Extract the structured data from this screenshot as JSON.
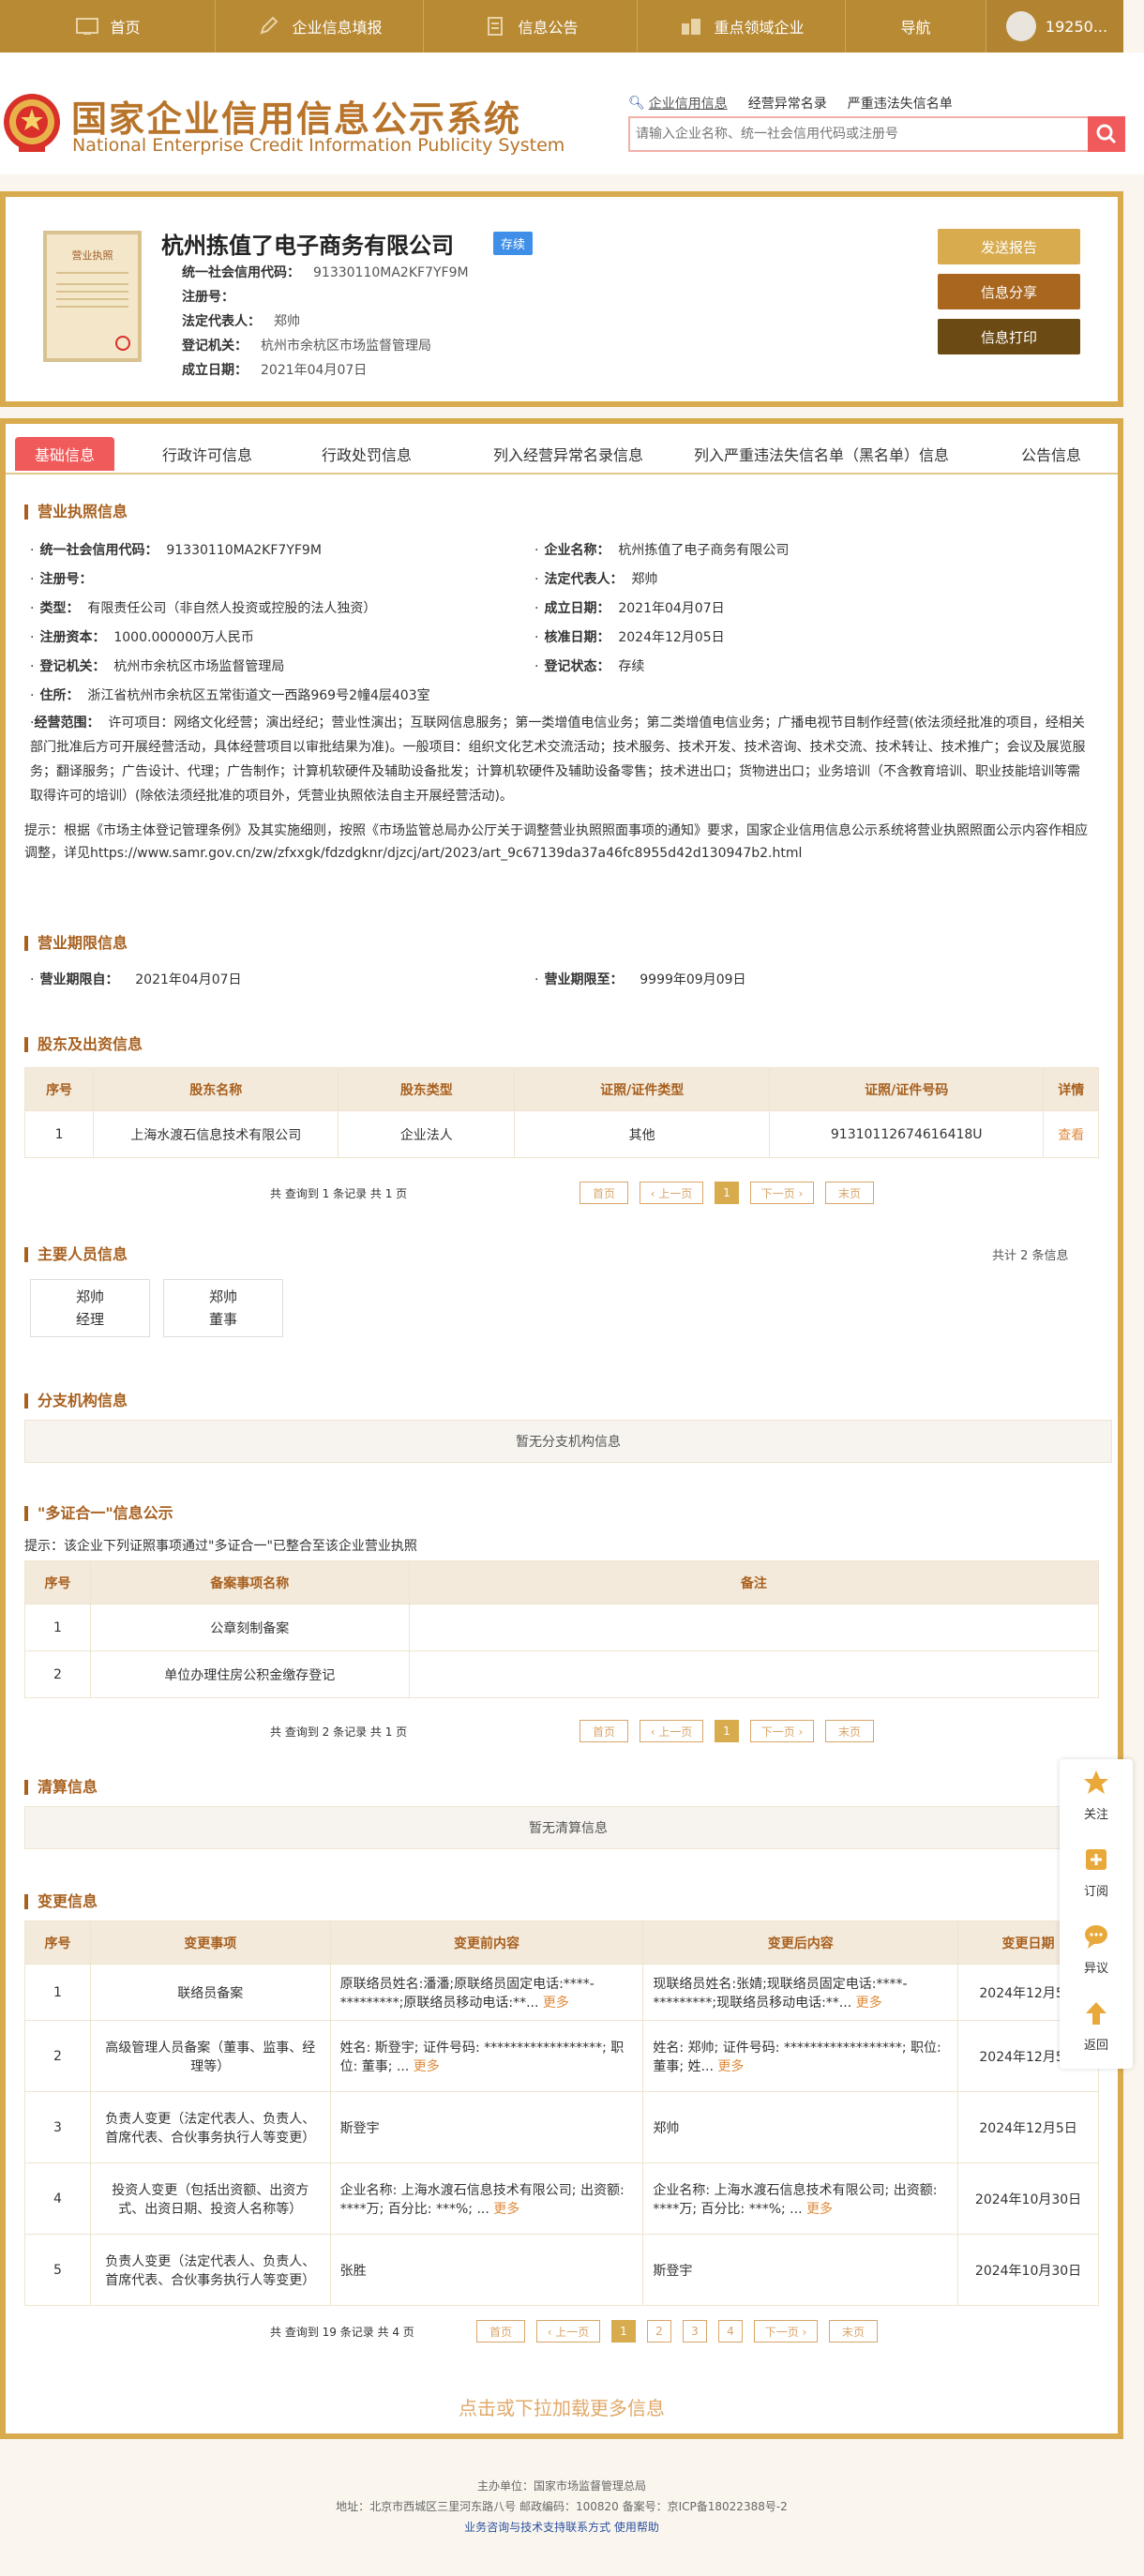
{
  "nav": {
    "items": [
      {
        "label": "首页",
        "icon": "home-icon"
      },
      {
        "label": "企业信息填报",
        "icon": "edit-icon"
      },
      {
        "label": "信息公告",
        "icon": "document-icon"
      },
      {
        "label": "重点领域企业",
        "icon": "building-icon"
      },
      {
        "label": "导航",
        "icon": "navigation-icon"
      }
    ],
    "user_label": "19250..."
  },
  "header": {
    "title_cn": "国家企业信用信息公示系统",
    "title_en": "National Enterprise Credit Information Publicity System",
    "search_links": [
      "企业信用信息",
      "经营异常名录",
      "严重违法失信名单"
    ],
    "search_placeholder": "请输入企业名称、统一社会信用代码或注册号"
  },
  "company": {
    "name": "杭州拣值了电子商务有限公司",
    "status": "存续",
    "license_image_text": "营业执照",
    "fields": [
      {
        "label": "统一社会信用代码：",
        "value": "91330110MA2KF7YF9M"
      },
      {
        "label": "注册号：",
        "value": ""
      },
      {
        "label": "法定代表人：",
        "value": "郑帅"
      },
      {
        "label": "登记机关：",
        "value": "杭州市余杭区市场监督管理局"
      },
      {
        "label": "成立日期：",
        "value": "2021年04月07日"
      }
    ],
    "buttons": {
      "report": "发送报告",
      "share": "信息分享",
      "print": "信息打印"
    }
  },
  "tabs": [
    "基础信息",
    "行政许可信息",
    "行政处罚信息",
    "列入经营异常名录信息",
    "列入严重违法失信名单（黑名单）信息",
    "公告信息"
  ],
  "license": {
    "title": "营业执照信息",
    "left": [
      {
        "label": "统一社会信用代码：",
        "value": "91330110MA2KF7YF9M"
      },
      {
        "label": "注册号：",
        "value": ""
      },
      {
        "label": "类型：",
        "value": "有限责任公司（非自然人投资或控股的法人独资）"
      },
      {
        "label": "注册资本：",
        "value": "1000.000000万人民币"
      },
      {
        "label": "登记机关：",
        "value": "杭州市余杭区市场监督管理局"
      },
      {
        "label": "住所：",
        "value": "浙江省杭州市余杭区五常街道文一西路969号2幢4层403室"
      }
    ],
    "right": [
      {
        "label": "企业名称：",
        "value": "杭州拣值了电子商务有限公司"
      },
      {
        "label": "法定代表人：",
        "value": "郑帅"
      },
      {
        "label": "成立日期：",
        "value": "2021年04月07日"
      },
      {
        "label": "核准日期：",
        "value": "2024年12月05日"
      },
      {
        "label": "登记状态：",
        "value": "存续"
      }
    ],
    "scope_label": "经营范围：",
    "scope_value": "许可项目：网络文化经营；演出经纪；营业性演出；互联网信息服务；第一类增值电信业务；第二类增值电信业务；广播电视节目制作经营(依法须经批准的项目，经相关部门批准后方可开展经营活动，具体经营项目以审批结果为准)。一般项目：组织文化艺术交流活动；技术服务、技术开发、技术咨询、技术交流、技术转让、技术推广；会议及展览服务；翻译服务；广告设计、代理；广告制作；计算机软硬件及辅助设备批发；计算机软硬件及辅助设备零售；技术进出口；货物进出口；业务培训（不含教育培训、职业技能培训等需取得许可的培训）(除依法须经批准的项目外，凭营业执照依法自主开展经营活动)。",
    "notice": "提示：根据《市场主体登记管理条例》及其实施细则，按照《市场监管总局办公厅关于调整营业执照照面事项的通知》要求，国家企业信用信息公示系统将营业执照照面公示内容作相应调整，详见https://www.samr.gov.cn/zw/zfxxgk/fdzdgknr/djzcj/art/2023/art_9c67139da37a46fc8955d42d130947b2.html"
  },
  "period": {
    "title": "营业期限信息",
    "from_label": "营业期限自：",
    "from_value": "2021年04月07日",
    "to_label": "营业期限至：",
    "to_value": "9999年09月09日"
  },
  "shareholders": {
    "title": "股东及出资信息",
    "headers": [
      "序号",
      "股东名称",
      "股东类型",
      "证照/证件类型",
      "证照/证件号码",
      "详情"
    ],
    "rows": [
      [
        "1",
        "上海水渡石信息技术有限公司",
        "企业法人",
        "其他",
        "91310112674616418U",
        "查看"
      ]
    ],
    "pager_text": "共 查询到 1 条记录 共 1 页",
    "pager": [
      "首页",
      "‹ 上一页",
      "1",
      "下一页 ›",
      "末页"
    ]
  },
  "personnel": {
    "title": "主要人员信息",
    "count_text": "共计 2 条信息",
    "people": [
      {
        "name": "郑帅",
        "role": "经理"
      },
      {
        "name": "郑帅",
        "role": "董事"
      }
    ]
  },
  "branches": {
    "title": "分支机构信息",
    "empty": "暂无分支机构信息"
  },
  "multi_cert": {
    "title": "\"多证合一\"信息公示",
    "tip": "提示：该企业下列证照事项通过\"多证合一\"已整合至该企业营业执照",
    "headers": [
      "序号",
      "备案事项名称",
      "备注"
    ],
    "rows": [
      [
        "1",
        "公章刻制备案",
        ""
      ],
      [
        "2",
        "单位办理住房公积金缴存登记",
        ""
      ]
    ],
    "pager_text": "共 查询到 2 条记录 共 1 页",
    "pager": [
      "首页",
      "‹ 上一页",
      "1",
      "下一页 ›",
      "末页"
    ]
  },
  "liquidation": {
    "title": "清算信息",
    "empty": "暂无清算信息"
  },
  "changes": {
    "title": "变更信息",
    "headers": [
      "序号",
      "变更事项",
      "变更前内容",
      "变更后内容",
      "变更日期"
    ],
    "rows": [
      [
        "1",
        "联络员备案",
        "原联络员姓名:潘潘;原联络员固定电话:****-*********;原联络员移动电话:**...",
        "现联络员姓名:张婧;现联络员固定电话:****-*********;现联络员移动电话:**...",
        "2024年12月5日"
      ],
      [
        "2",
        "高级管理人员备案（董事、监事、经理等）",
        "姓名: 斯登宇; 证件号码: ******************; 职位: 董事; ...",
        "姓名: 郑帅; 证件号码: ******************; 职位: 董事; 姓...",
        "2024年12月5日"
      ],
      [
        "3",
        "负责人变更（法定代表人、负责人、首席代表、合伙事务执行人等变更）",
        "斯登宇",
        "郑帅",
        "2024年12月5日"
      ],
      [
        "4",
        "投资人变更（包括出资额、出资方式、出资日期、投资人名称等）",
        "企业名称: 上海水渡石信息技术有限公司; 出资额: ****万; 百分比: ***%; ...",
        "企业名称: 上海水渡石信息技术有限公司; 出资额: ****万; 百分比: ***%; ...",
        "2024年10月30日"
      ],
      [
        "5",
        "负责人变更（法定代表人、负责人、首席代表、合伙事务执行人等变更）",
        "张胜",
        "斯登宇",
        "2024年10月30日"
      ]
    ],
    "more": "更多",
    "pager_text": "共 查询到 19 条记录 共 4 页",
    "pager": [
      "首页",
      "‹ 上一页",
      "1",
      "2",
      "3",
      "4",
      "下一页 ›",
      "末页"
    ]
  },
  "load_more": "点击或下拉加载更多信息",
  "float_bar": [
    "关注",
    "订阅",
    "异议",
    "返回"
  ],
  "footer": {
    "line1": "主办单位：国家市场监督管理总局",
    "line2": "地址：北京市西城区三里河东路八号    邮政编码：100820    备案号：京ICP备18022388号-2",
    "links": "业务咨询与技术支持联系方式      使用帮助"
  }
}
